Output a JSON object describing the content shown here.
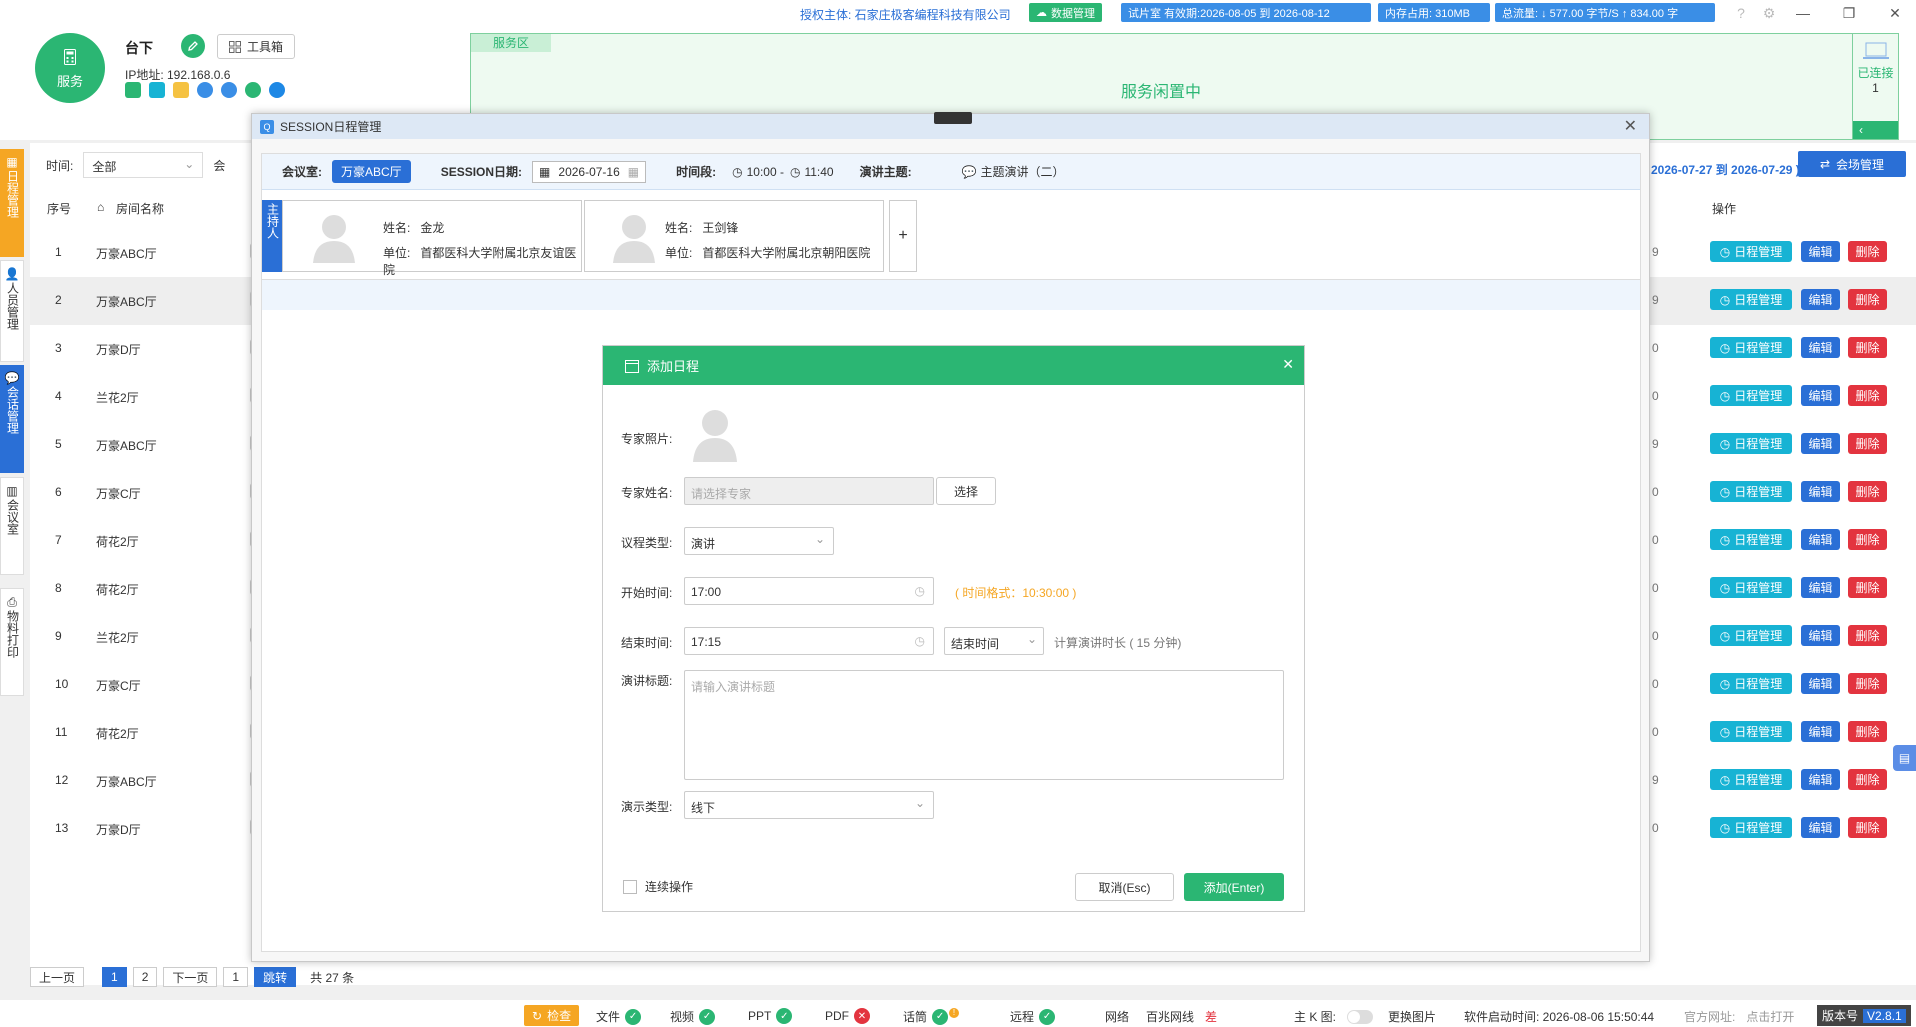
{
  "header": {
    "logo_label": "服务",
    "title": "台下",
    "toolbox_label": "工具箱",
    "ip_label": "IP地址: 192.168.0.6",
    "auth_prefix": "授权主体: ",
    "auth_company": "石家庄极客编程科技有限公司",
    "data_mgmt_label": "数据管理",
    "trial_label": "试片室 有效期:2026-08-05 到 2026-08-12",
    "memory_label": "内存占用:   310MB",
    "traffic_label": "总流量: ↓ 577.00 字节/S   ↑ 834.00 字",
    "service_area_label": "服务区",
    "service_status": "服务闲置中",
    "connected_label": "已连接",
    "connected_count": "1"
  },
  "left_nav": {
    "items": [
      "日程管理",
      "人员管理",
      "会话管理",
      "会议室",
      "物料打印"
    ]
  },
  "filter": {
    "time_label": "时间:",
    "time_value": "全部",
    "venue_label": "会",
    "date_range": "2026-07-27 到 2026-07-29 )",
    "venue_mgmt_button": "会场管理"
  },
  "table": {
    "col_index": "序号",
    "col_room": "房间名称",
    "col_ops": "操作",
    "op_schedule": "日程管理",
    "op_edit": "编辑",
    "op_delete": "删除",
    "rows": [
      {
        "idx": "1",
        "room": "万豪ABC厅",
        "tail": "9"
      },
      {
        "idx": "2",
        "room": "万豪ABC厅",
        "tail": "9"
      },
      {
        "idx": "3",
        "room": "万豪D厅",
        "tail": "0"
      },
      {
        "idx": "4",
        "room": "兰花2厅",
        "tail": "0"
      },
      {
        "idx": "5",
        "room": "万豪ABC厅",
        "tail": "9"
      },
      {
        "idx": "6",
        "room": "万豪C厅",
        "tail": "0"
      },
      {
        "idx": "7",
        "room": "荷花2厅",
        "tail": "0"
      },
      {
        "idx": "8",
        "room": "荷花2厅",
        "tail": "0"
      },
      {
        "idx": "9",
        "room": "兰花2厅",
        "tail": "0"
      },
      {
        "idx": "10",
        "room": "万豪C厅",
        "tail": "0"
      },
      {
        "idx": "11",
        "room": "荷花2厅",
        "tail": "0"
      },
      {
        "idx": "12",
        "room": "万豪ABC厅",
        "tail": "9"
      },
      {
        "idx": "13",
        "room": "万豪D厅",
        "tail": "0"
      }
    ]
  },
  "pager": {
    "prev": "上一页",
    "pages": [
      "1",
      "2"
    ],
    "next": "下一页",
    "jump_value": "1",
    "jump": "跳转",
    "total": "共 27 条"
  },
  "session_window": {
    "title": "SESSION日程管理",
    "room_label": "会议室:",
    "room_value": "万豪ABC厅",
    "date_label": "SESSION日期:",
    "date_value": "2026-07-16",
    "period_label": "时间段:",
    "period_start": "10:00 -",
    "period_end": "11:40",
    "topic_label": "演讲主题:",
    "topic_value": "主题演讲（二）",
    "host_tag": "主持人",
    "hosts": [
      {
        "name_label": "姓名:",
        "name": "金龙",
        "unit_label": "单位:",
        "unit": "首都医科大学附属北京友谊医院"
      },
      {
        "name_label": "姓名:",
        "name": "王剑锋",
        "unit_label": "单位:",
        "unit": "首都医科大学附属北京朝阳医院"
      }
    ],
    "add_host": "+"
  },
  "dialog": {
    "title": "添加日程",
    "photo_label": "专家照片:",
    "name_label": "专家姓名:",
    "name_placeholder": "请选择专家",
    "select_button": "选择",
    "type_label": "议程类型:",
    "type_value": "演讲",
    "start_label": "开始时间:",
    "start_value": "17:00",
    "time_hint": "( 时间格式：10:30:00 )",
    "end_label": "结束时间:",
    "end_value": "17:15",
    "end_mode": "结束时间",
    "duration_hint": "计算演讲时长 ( 15 分钟)",
    "talk_title_label": "演讲标题:",
    "talk_title_placeholder": "请输入演讲标题",
    "present_label": "演示类型:",
    "present_value": "线下",
    "continuous_label": "连续操作",
    "cancel_button": "取消(Esc)",
    "add_button": "添加(Enter)"
  },
  "status_bar": {
    "check": "检查",
    "file": "文件",
    "video": "视频",
    "ppt": "PPT",
    "pdf": "PDF",
    "talk": "话筒",
    "remote": "远程",
    "net_label": "网络",
    "net_value": "百兆网线",
    "net_quality": "差",
    "kmap": "主 K 图:",
    "change_image": "更换图片",
    "start_time": "软件启动时间:  2026-08-06 15:50:44",
    "official_label": "官方网址:",
    "official_link": "点击打开",
    "version_label": "版本号",
    "version_value": "V2.8.1"
  },
  "colors": {
    "green": "#2bb673",
    "blue": "#2a6fd6",
    "cyan": "#17b3d4",
    "red": "#e3343f",
    "orange": "#f5a623"
  }
}
